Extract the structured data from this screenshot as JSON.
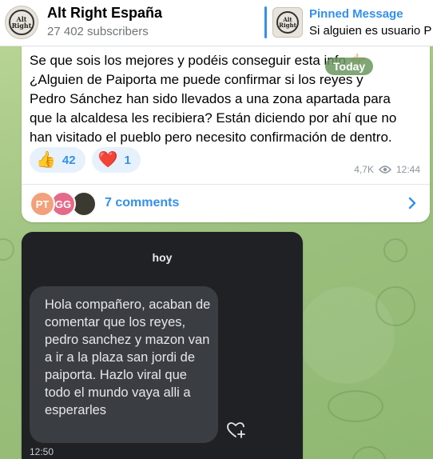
{
  "header": {
    "channel_title": "Alt Right España",
    "subscribers": "27 402 subscribers",
    "avatar_text_line1": "Alt",
    "avatar_text_line2": "Right",
    "avatar_icon": "channel-logo",
    "pinned": {
      "title": "Pinned Message",
      "text": "Si alguien es usuario P"
    }
  },
  "message": {
    "text": "Se que sois los mejores y podéis conseguir esta info 👉🏻 ¿Alguien de Paiporta me puede confirmar si los reyes y Pedro Sánchez han sido llevados a una zona apartada para que la alcaldesa les recibiera? Están diciendo por ahí que no han visitado el pueblo pero necesito confirmación de dentro.",
    "date_pill": "Today",
    "reactions": [
      {
        "emoji": "👍",
        "count": "42"
      },
      {
        "emoji": "❤️",
        "count": "1"
      }
    ],
    "views": "4,7K",
    "time": "12:44",
    "comments": {
      "avatars": [
        {
          "initials": "PT",
          "color": "#f2a17a"
        },
        {
          "initials": "GG",
          "color": "#e56a8a"
        },
        {
          "initials": "",
          "color": "#3a3a30"
        }
      ],
      "label": "7 comments"
    }
  },
  "photo": {
    "header": "hoy",
    "bubble_text": "Hola compañero, acaban de comentar que los reyes, pedro sanchez y mazon van a ir a la plaza san jordi de paiporta. Hazlo viral que todo el mundo vaya alli a esperarles",
    "time": "12:50"
  },
  "colors": {
    "accent": "#3390ec",
    "reaction_bg": "#e6f1fc",
    "wallpaper": "#a9c88b"
  }
}
